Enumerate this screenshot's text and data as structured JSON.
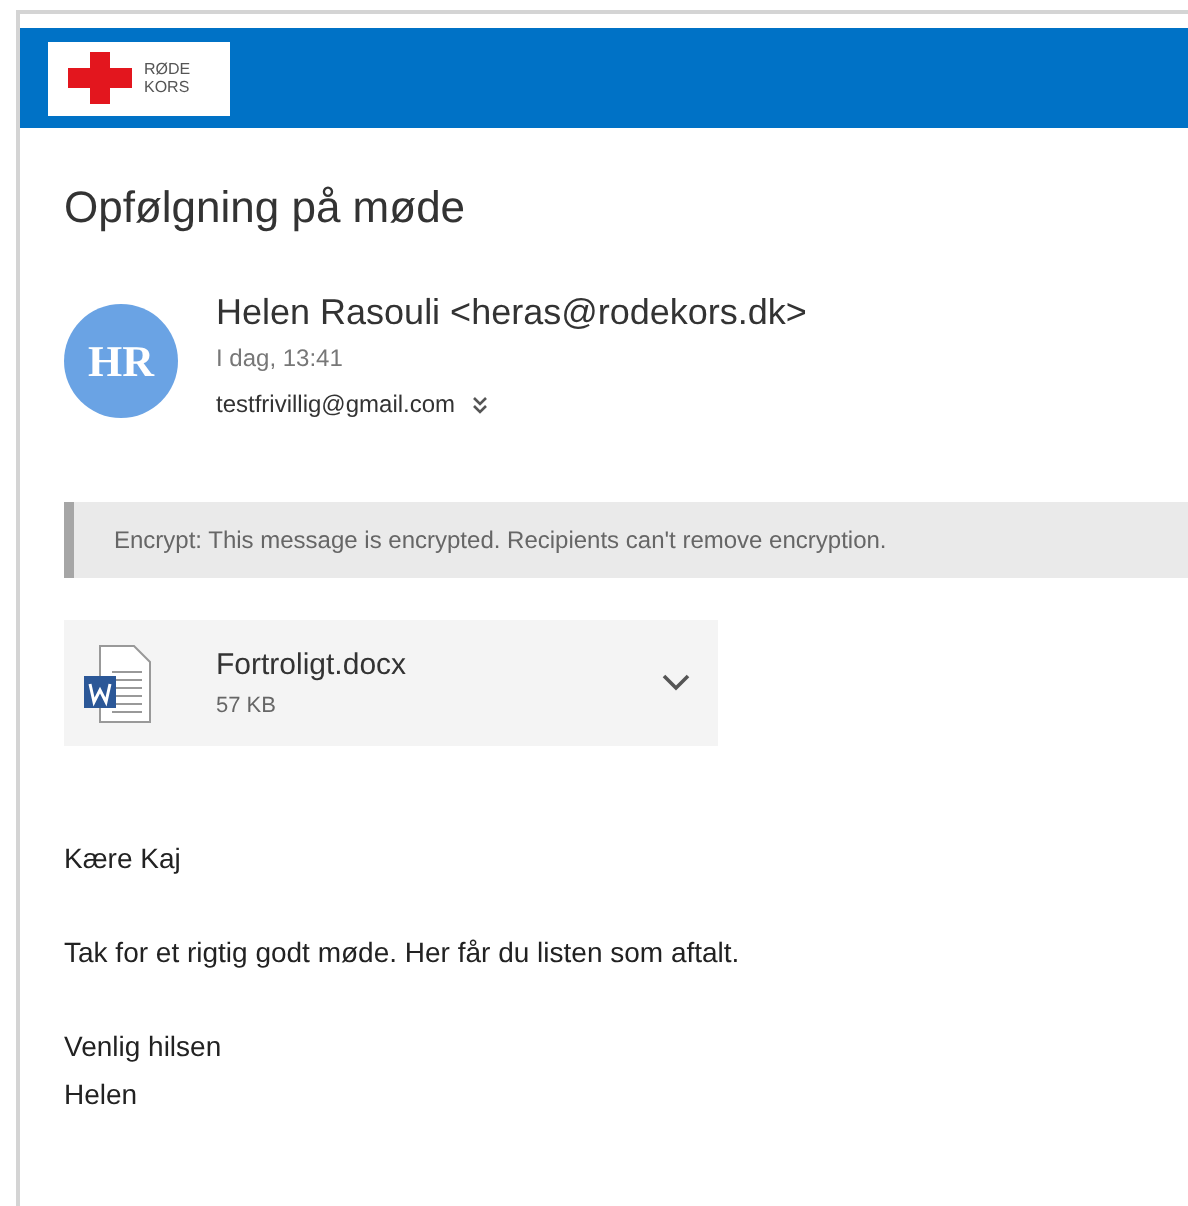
{
  "header": {
    "logo_text": [
      "RØDE",
      "KORS"
    ]
  },
  "subject": "Opfølgning på møde",
  "sender": {
    "initials": "HR",
    "name": "Helen Rasouli <heras@rodekors.dk>",
    "time": "I dag, 13:41",
    "recipient": "testfrivillig@gmail.com"
  },
  "notice": "Encrypt: This message is encrypted. Recipients can't remove encryption.",
  "attachment": {
    "name": "Fortroligt.docx",
    "size": "57 KB"
  },
  "body": [
    "Kære Kaj",
    "Tak for et rigtig godt møde. Her får du listen som aftalt.",
    "Venlig hilsen\nHelen"
  ]
}
